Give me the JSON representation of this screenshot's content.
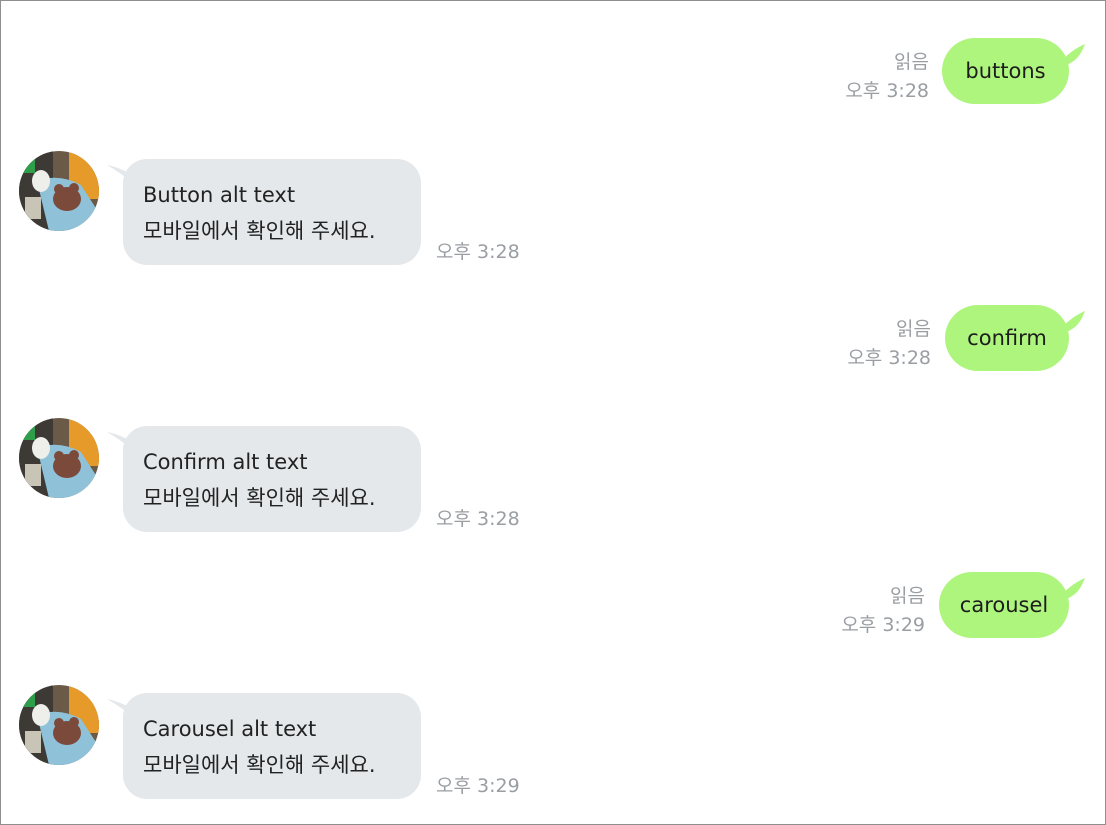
{
  "colors": {
    "outgoing_bubble": "#aef57d",
    "incoming_bubble": "#e4e8eb",
    "meta_text": "#9a9ea3"
  },
  "messages": [
    {
      "type": "out",
      "text": "buttons",
      "read": "읽음",
      "time": "오후 3:28"
    },
    {
      "type": "in",
      "line1": "Button alt text",
      "line2": "모바일에서 확인해 주세요.",
      "time": "오후 3:28",
      "avatar_icon": "profile-photo"
    },
    {
      "type": "out",
      "text": "confirm",
      "read": "읽음",
      "time": "오후 3:28"
    },
    {
      "type": "in",
      "line1": "Confirm alt text",
      "line2": "모바일에서 확인해 주세요.",
      "time": "오후 3:28",
      "avatar_icon": "profile-photo"
    },
    {
      "type": "out",
      "text": "carousel",
      "read": "읽음",
      "time": "오후 3:29"
    },
    {
      "type": "in",
      "line1": "Carousel alt text",
      "line2": "모바일에서 확인해 주세요.",
      "time": "오후 3:29",
      "avatar_icon": "profile-photo"
    }
  ]
}
